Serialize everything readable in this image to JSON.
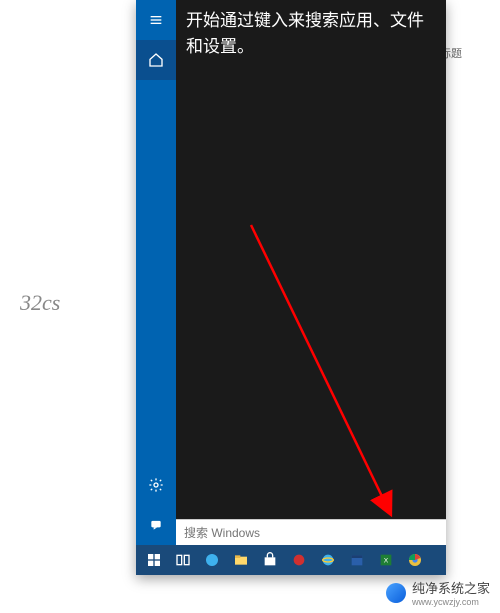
{
  "search_panel": {
    "prompt_text": "开始通过键入来搜索应用、文件和设置。",
    "input_placeholder": "搜索 Windows"
  },
  "left_rail": {
    "menu_icon": "menu",
    "home_icon": "home",
    "settings_icon": "settings",
    "feedback_icon": "feedback"
  },
  "taskbar": {
    "items": [
      {
        "name": "start"
      },
      {
        "name": "taskview"
      },
      {
        "name": "edge"
      },
      {
        "name": "explorer"
      },
      {
        "name": "store"
      },
      {
        "name": "app-red"
      },
      {
        "name": "ie"
      },
      {
        "name": "calendar"
      },
      {
        "name": "excel"
      },
      {
        "name": "chrome"
      }
    ]
  },
  "peek": {
    "label": "标题"
  },
  "watermark": {
    "left_text": "32cs",
    "bottom_text": "纯净系统之家",
    "bottom_url": "www.ycwzjy.com"
  }
}
